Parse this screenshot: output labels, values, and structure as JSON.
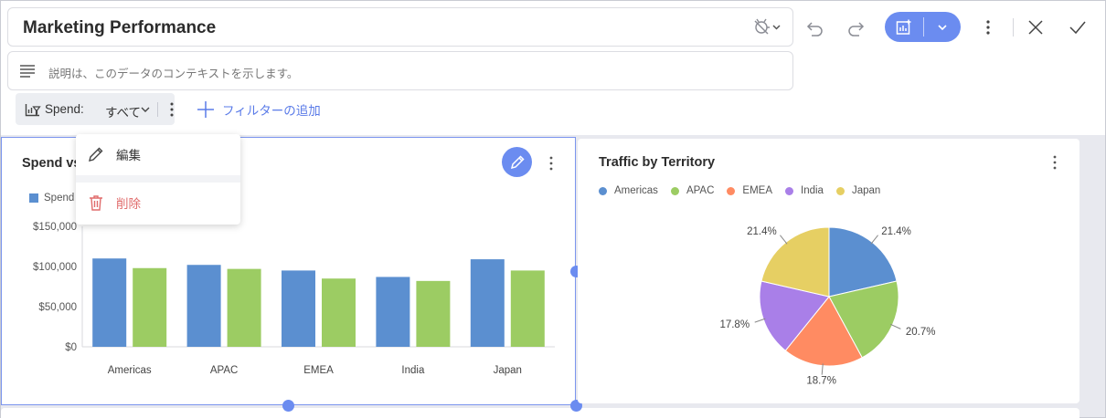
{
  "header": {
    "title": "Marketing Performance",
    "description_placeholder": "説明は、このデータのコンテキストを示します。"
  },
  "filters": {
    "chip_label": "Spend:",
    "chip_value": "すべて",
    "add_filter_label": "フィルターの追加"
  },
  "context_menu": {
    "edit_label": "編集",
    "delete_label": "削除"
  },
  "colors": {
    "accent": "#6b8cf0",
    "delete": "#e06b6b",
    "series_blue": "#5b8fd0",
    "series_green": "#9ccc63"
  },
  "widgets": {
    "spend_chart": {
      "title_visible": "Spend vs",
      "legend_visible": "Spend"
    },
    "traffic_chart": {
      "title": "Traffic by Territory"
    }
  },
  "chart_data": [
    {
      "type": "bar",
      "title": "Spend vs",
      "categories": [
        "Americas",
        "APAC",
        "EMEA",
        "India",
        "Japan"
      ],
      "series": [
        {
          "name": "Spend",
          "color": "#5b8fd0",
          "values": [
            110000,
            102000,
            95000,
            87000,
            109000
          ]
        },
        {
          "color": "#9ccc63",
          "values": [
            98000,
            97000,
            85000,
            82000,
            95000
          ]
        }
      ],
      "ylim": [
        0,
        150000
      ],
      "yticks": [
        "$0",
        "$50,000",
        "$100,000",
        "$150,000"
      ],
      "legend_position": "top-left"
    },
    {
      "type": "pie",
      "title": "Traffic by Territory",
      "labels": [
        "Americas",
        "APAC",
        "EMEA",
        "India",
        "Japan"
      ],
      "values": [
        21.4,
        20.7,
        18.7,
        17.8,
        21.4
      ],
      "value_labels": [
        "21.4%",
        "20.7%",
        "18.7%",
        "17.8%",
        "21.4%"
      ],
      "colors": [
        "#5b8fd0",
        "#9ccc63",
        "#ff8b62",
        "#a97fe8",
        "#e6cf63"
      ],
      "legend_position": "top"
    }
  ]
}
